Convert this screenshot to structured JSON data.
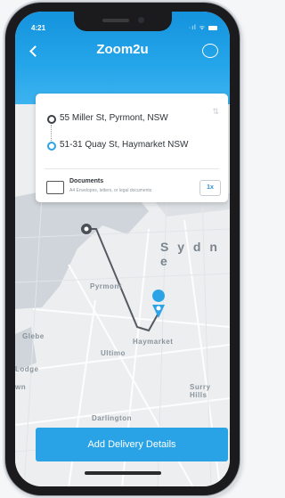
{
  "status_bar": {
    "time": "4:21",
    "signal": "·ıl ᯤ"
  },
  "header": {
    "logo": "Zoom2u"
  },
  "route": {
    "pickup": "55 Miller St, Pyrmont, NSW",
    "dropoff": "51-31 Quay St, Haymarket NSW"
  },
  "package": {
    "title": "Documents",
    "subtitle": "A4 Envelopes, letters, or legal documents",
    "quantity": "1x"
  },
  "map_labels": {
    "sydney": "S y d n e",
    "pyrmont": "Pyrmont",
    "glebe": "Glebe",
    "ultimo": "Ultimo",
    "haymarket": "Haymarket",
    "lodge": "Lodge",
    "wn": "wn",
    "surry_hills": "Surry Hills",
    "darlington": "Darlington"
  },
  "cta": {
    "label": "Add Delivery Details"
  },
  "colors": {
    "primary": "#2aa3e6",
    "header": "#1a9be2",
    "route_line": "#555b61"
  }
}
